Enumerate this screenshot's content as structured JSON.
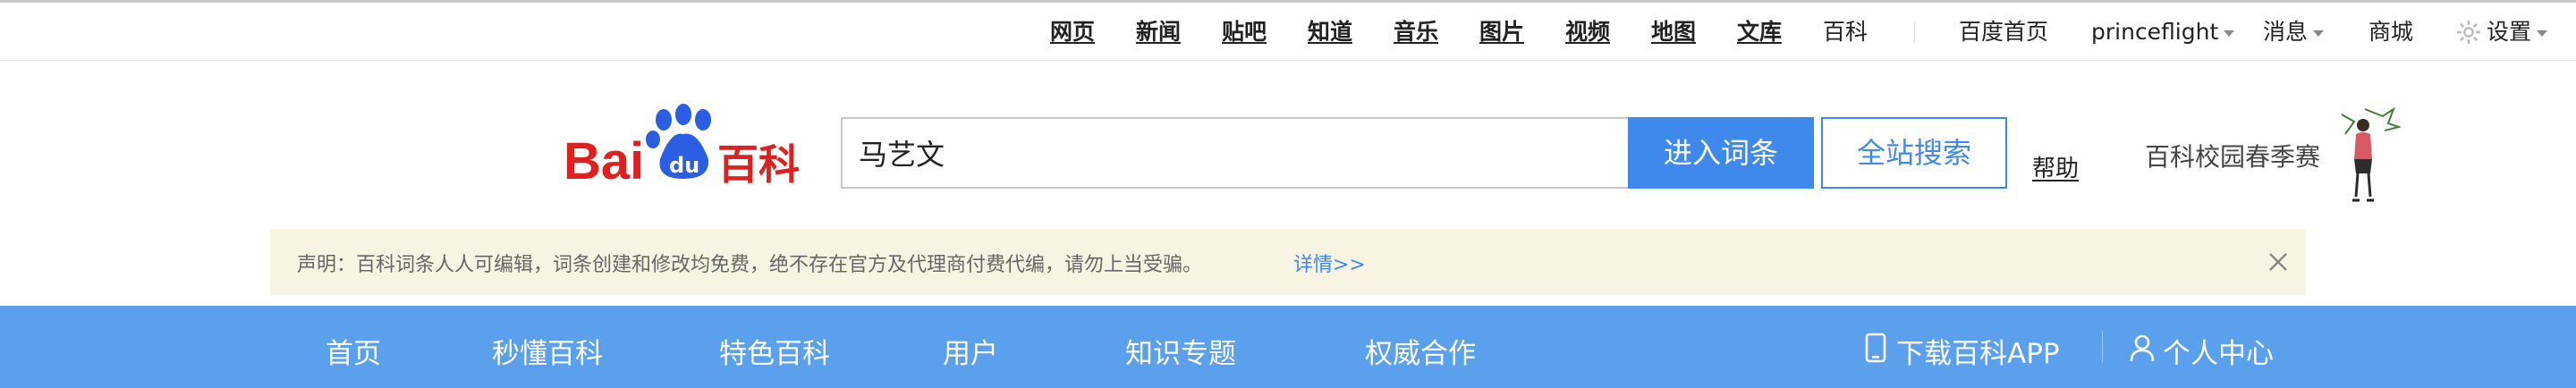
{
  "topnav": {
    "items": [
      "网页",
      "新闻",
      "贴吧",
      "知道",
      "音乐",
      "图片",
      "视频",
      "地图",
      "文库"
    ],
    "current": "百科"
  },
  "topright": {
    "home": "百度首页",
    "user": "princeflight",
    "messages": "消息",
    "mall": "商城",
    "settings": "设置"
  },
  "logo": {
    "text": "Bai",
    "du": "du",
    "baike": "百科"
  },
  "search": {
    "value": "马艺文",
    "enter_label": "进入词条",
    "site_search_label": "全站搜索",
    "help_label": "帮助"
  },
  "campus_label": "百科校园春季赛",
  "notice": {
    "text": "声明：百科词条人人可编辑，词条创建和修改均免费，绝不存在官方及代理商付费代编，请勿上当受骗。",
    "link": "详情>>"
  },
  "mainnav": {
    "items": [
      "首页",
      "秒懂百科",
      "特色百科",
      "用户",
      "知识专题",
      "权威合作"
    ],
    "download_app": "下载百科APP",
    "personal_center": "个人中心"
  },
  "colors": {
    "accent": "#3f89ec",
    "nav_bg": "#5aa0ec",
    "notice_bg": "#f8f4e3",
    "logo_red": "#de2020",
    "logo_blue": "#2b5ee3"
  }
}
